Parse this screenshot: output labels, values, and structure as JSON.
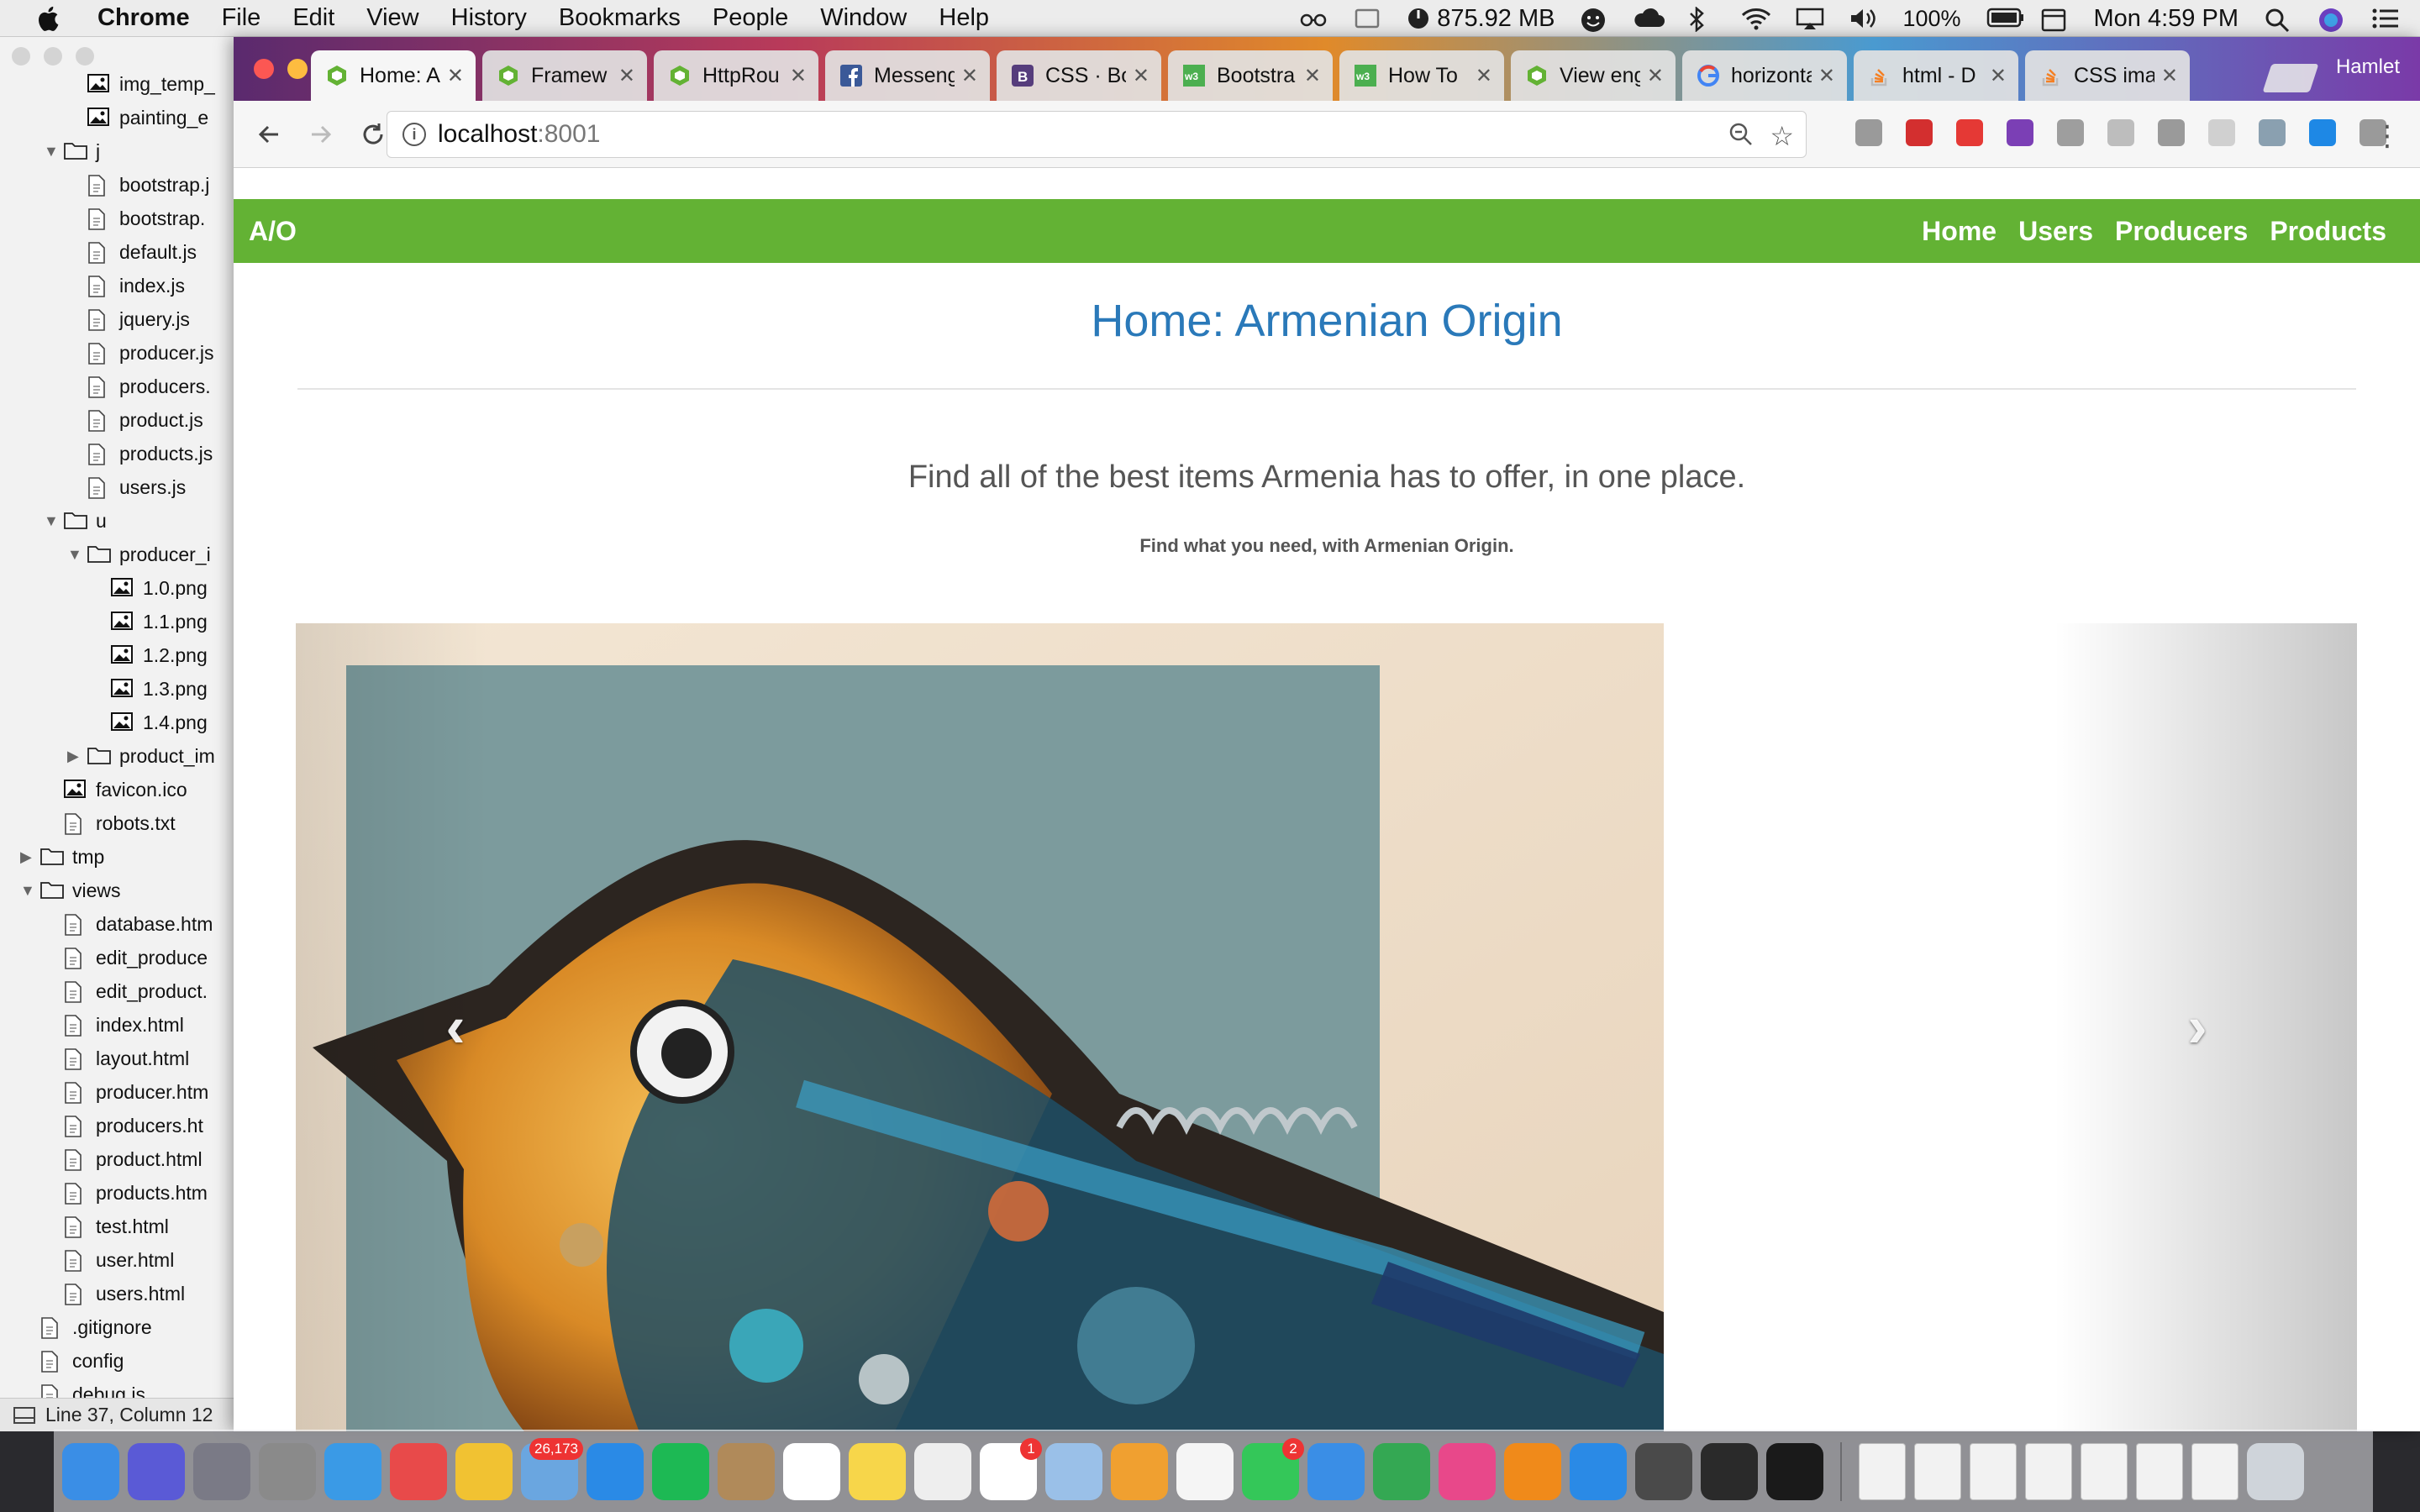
{
  "menubar": {
    "app_name": "Chrome",
    "items": [
      "File",
      "Edit",
      "View",
      "History",
      "Bookmarks",
      "People",
      "Window",
      "Help"
    ],
    "memory": "875.92 MB",
    "battery": "100%",
    "clock": "Mon 4:59 PM"
  },
  "editor": {
    "tree": [
      {
        "label": "img_temp_",
        "indent": 2,
        "type": "image"
      },
      {
        "label": "painting_e",
        "indent": 2,
        "type": "image"
      },
      {
        "label": "j",
        "indent": 1,
        "type": "folder-open"
      },
      {
        "label": "bootstrap.j",
        "indent": 2,
        "type": "file"
      },
      {
        "label": "bootstrap.",
        "indent": 2,
        "type": "file"
      },
      {
        "label": "default.js",
        "indent": 2,
        "type": "file"
      },
      {
        "label": "index.js",
        "indent": 2,
        "type": "file"
      },
      {
        "label": "jquery.js",
        "indent": 2,
        "type": "file"
      },
      {
        "label": "producer.js",
        "indent": 2,
        "type": "file"
      },
      {
        "label": "producers.",
        "indent": 2,
        "type": "file"
      },
      {
        "label": "product.js",
        "indent": 2,
        "type": "file"
      },
      {
        "label": "products.js",
        "indent": 2,
        "type": "file"
      },
      {
        "label": "users.js",
        "indent": 2,
        "type": "file"
      },
      {
        "label": "u",
        "indent": 1,
        "type": "folder-open"
      },
      {
        "label": "producer_i",
        "indent": 2,
        "type": "folder-open"
      },
      {
        "label": "1.0.png",
        "indent": 3,
        "type": "image"
      },
      {
        "label": "1.1.png",
        "indent": 3,
        "type": "image"
      },
      {
        "label": "1.2.png",
        "indent": 3,
        "type": "image"
      },
      {
        "label": "1.3.png",
        "indent": 3,
        "type": "image"
      },
      {
        "label": "1.4.png",
        "indent": 3,
        "type": "image"
      },
      {
        "label": "product_im",
        "indent": 2,
        "type": "folder-closed"
      },
      {
        "label": "favicon.ico",
        "indent": 1,
        "type": "image"
      },
      {
        "label": "robots.txt",
        "indent": 1,
        "type": "file"
      },
      {
        "label": "tmp",
        "indent": 0,
        "type": "folder-closed"
      },
      {
        "label": "views",
        "indent": 0,
        "type": "folder-open"
      },
      {
        "label": "database.htm",
        "indent": 1,
        "type": "file"
      },
      {
        "label": "edit_produce",
        "indent": 1,
        "type": "file"
      },
      {
        "label": "edit_product.",
        "indent": 1,
        "type": "file"
      },
      {
        "label": "index.html",
        "indent": 1,
        "type": "file"
      },
      {
        "label": "layout.html",
        "indent": 1,
        "type": "file"
      },
      {
        "label": "producer.htm",
        "indent": 1,
        "type": "file"
      },
      {
        "label": "producers.ht",
        "indent": 1,
        "type": "file"
      },
      {
        "label": "product.html",
        "indent": 1,
        "type": "file"
      },
      {
        "label": "products.htm",
        "indent": 1,
        "type": "file"
      },
      {
        "label": "test.html",
        "indent": 1,
        "type": "file"
      },
      {
        "label": "user.html",
        "indent": 1,
        "type": "file"
      },
      {
        "label": "users.html",
        "indent": 1,
        "type": "file"
      },
      {
        "label": ".gitignore",
        "indent": 0,
        "type": "file"
      },
      {
        "label": "config",
        "indent": 0,
        "type": "file"
      },
      {
        "label": "debug.js",
        "indent": 0,
        "type": "file"
      }
    ],
    "status": "Line 37, Column 12"
  },
  "browser": {
    "tabs": [
      {
        "title": "Home: A",
        "icon": "green-hex-icon",
        "active": true
      },
      {
        "title": "Framew",
        "icon": "green-hex-icon"
      },
      {
        "title": "HttpRou",
        "icon": "green-hex-icon"
      },
      {
        "title": "Messeng",
        "icon": "facebook-icon"
      },
      {
        "title": "CSS · Bo",
        "icon": "bootstrap-icon"
      },
      {
        "title": "Bootstra",
        "icon": "w3schools-icon"
      },
      {
        "title": "How To",
        "icon": "w3schools-icon"
      },
      {
        "title": "View eng",
        "icon": "green-hex-icon"
      },
      {
        "title": "horizonta",
        "icon": "google-icon"
      },
      {
        "title": "html - D",
        "icon": "stackoverflow-icon"
      },
      {
        "title": "CSS ima",
        "icon": "stackoverflow-icon"
      }
    ],
    "profile": "Hamlet",
    "url_host": "localhost",
    "url_port": ":8001",
    "extensions": [
      "js-ext-icon",
      "adblock-icon",
      "opera-icon",
      "onenote-icon",
      "drive-icon",
      "grid-ext-icon",
      "r-ext-icon",
      "ext-icon",
      "skype-icon",
      "s-ext-icon",
      "ext2-icon"
    ]
  },
  "site": {
    "brand": "A/O",
    "nav": [
      "Home",
      "Users",
      "Producers",
      "Products"
    ],
    "title": "Home: Armenian Origin",
    "lead": "Find all of the best items Armenia has to offer, in one place.",
    "sublead": "Find what you need, with Armenian Origin.",
    "carousel": {
      "prev": "‹",
      "next": "›"
    }
  },
  "dock": {
    "items": [
      {
        "name": "finder-icon",
        "color": "#3a8ee6"
      },
      {
        "name": "siri-icon",
        "color": "#5a5ad6"
      },
      {
        "name": "launchpad-icon",
        "color": "#7a7a86"
      },
      {
        "name": "system-prefs-icon",
        "color": "#8a8a8a"
      },
      {
        "name": "safari-icon",
        "color": "#3a9ae6"
      },
      {
        "name": "apps-grid-icon",
        "color": "#e84a4a"
      },
      {
        "name": "chrome-icon",
        "color": "#f1c232"
      },
      {
        "name": "mail-icon",
        "color": "#6aa6e0",
        "badge": "26,173"
      },
      {
        "name": "messages-bubble-icon",
        "color": "#2a8ae6"
      },
      {
        "name": "spotify-icon",
        "color": "#1db954"
      },
      {
        "name": "contacts-icon",
        "color": "#b08a5a"
      },
      {
        "name": "calendar-icon",
        "color": "#ffffff"
      },
      {
        "name": "notes-icon",
        "color": "#f7d64a"
      },
      {
        "name": "textedit-icon",
        "color": "#eeeeee"
      },
      {
        "name": "reminders-icon",
        "color": "#ffffff",
        "badge": "1"
      },
      {
        "name": "preview-icon",
        "color": "#9ac0e8"
      },
      {
        "name": "pages-icon",
        "color": "#f0a030"
      },
      {
        "name": "photos-icon",
        "color": "#f5f5f5"
      },
      {
        "name": "facetime-icon",
        "color": "#34c759",
        "badge": "2"
      },
      {
        "name": "keynote-icon",
        "color": "#3a8ee6"
      },
      {
        "name": "numbers-icon",
        "color": "#34a853"
      },
      {
        "name": "itunes-icon",
        "color": "#e8488a"
      },
      {
        "name": "ibooks-icon",
        "color": "#f08a1a"
      },
      {
        "name": "app-store-icon",
        "color": "#2a8ae6"
      },
      {
        "name": "sublime-icon",
        "color": "#4a4a4a"
      },
      {
        "name": "activity-monitor-icon",
        "color": "#2a2a2a"
      },
      {
        "name": "terminal-icon",
        "color": "#1a1a1a"
      }
    ],
    "right_items": [
      {
        "name": "document-icon",
        "color": "#f2f2f2"
      },
      {
        "name": "document-icon",
        "color": "#f2f2f2"
      },
      {
        "name": "document-icon",
        "color": "#f2f2f2"
      },
      {
        "name": "document-icon",
        "color": "#f2f2f2"
      },
      {
        "name": "document-icon",
        "color": "#f2f2f2"
      },
      {
        "name": "document-icon",
        "color": "#f2f2f2"
      },
      {
        "name": "document-icon",
        "color": "#f2f2f2"
      },
      {
        "name": "trash-icon",
        "color": "#cfd4da"
      }
    ]
  }
}
